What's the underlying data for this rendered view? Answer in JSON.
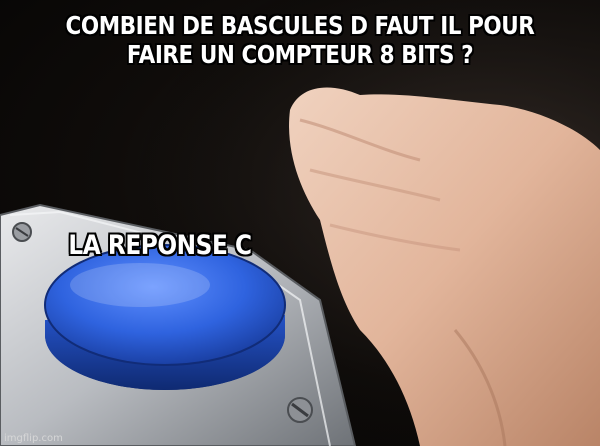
{
  "meme": {
    "top_text": "COMBIEN DE BASCULES D FAUT IL POUR FAIRE UN COMPTEUR 8 BITS ?",
    "button_text": "LA REPONSE C",
    "watermark": "imgflip.com"
  }
}
